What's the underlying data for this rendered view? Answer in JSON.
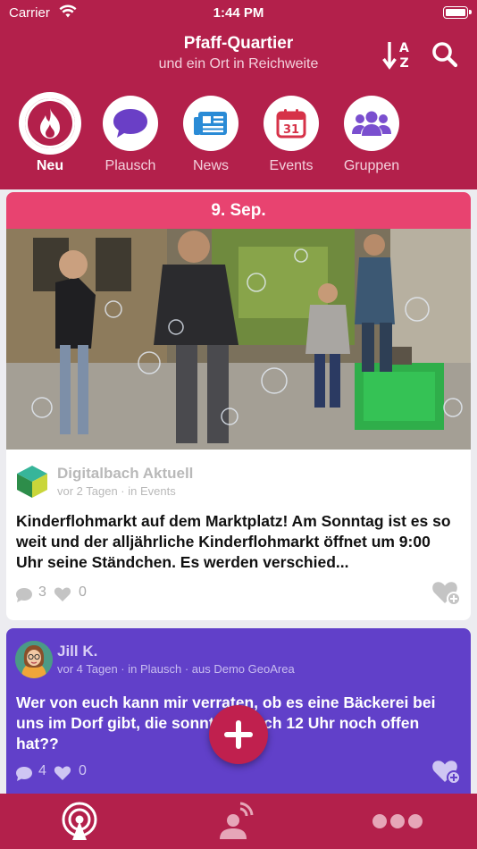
{
  "status": {
    "carrier": "Carrier",
    "time": "1:44 PM"
  },
  "header": {
    "title": "Pfaff-Quartier",
    "subtitle": "und ein Ort in Reichweite"
  },
  "categories": [
    {
      "label": "Neu",
      "icon": "fire-icon",
      "active": true
    },
    {
      "label": "Plausch",
      "icon": "chat-bubble-icon"
    },
    {
      "label": "News",
      "icon": "newspaper-icon"
    },
    {
      "label": "Events",
      "icon": "calendar-icon"
    },
    {
      "label": "Gruppen",
      "icon": "group-icon"
    }
  ],
  "post1": {
    "date": "9. Sep.",
    "author": "Digitalbach Aktuell",
    "meta": "vor 2 Tagen · in Events",
    "text": "Kinderflohmarkt auf dem Marktplatz! Am Sonntag ist es so weit und der alljährliche Kinderflohmarkt öffnet um 9:00 Uhr seine Ständchen. Es werden verschied...",
    "comments": "3",
    "likes": "0"
  },
  "post2": {
    "author": "Jill K.",
    "meta": "vor 4 Tagen · in Plausch · aus Demo GeoArea",
    "text": "Wer von euch kann mir verraten, ob es eine Bäckerei bei uns im Dorf gibt, die sonntags nach 12 Uhr noch offen hat??",
    "comments": "4",
    "likes": "0"
  },
  "colors": {
    "brand": "#b3204b",
    "date_bar": "#e84370",
    "plausch": "#6140c9"
  },
  "tabs": [
    {
      "icon": "broadcast-icon",
      "active": true
    },
    {
      "icon": "person-signal-icon"
    },
    {
      "icon": "more-icon"
    }
  ]
}
